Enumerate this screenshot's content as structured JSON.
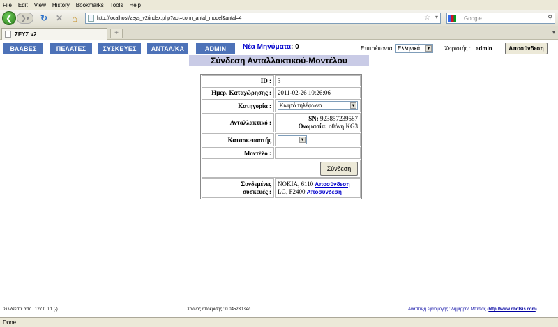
{
  "browser": {
    "menu": [
      "File",
      "Edit",
      "View",
      "History",
      "Bookmarks",
      "Tools",
      "Help"
    ],
    "url": "http://localhost/zeys_v2/index.php?act=conn_antal_model&antal=4",
    "search_placeholder": "Google",
    "tab_title": "ΖΕΥΣ v2",
    "status": "Done"
  },
  "nav": {
    "items": [
      "ΒΛΑΒΕΣ",
      "ΠΕΛΑΤΕΣ",
      "ΣΥΣΚΕΥΕΣ",
      "ΑΝΤΑΛ/ΚΑ",
      "ADMIN"
    ],
    "new_messages_label": "Νέα Μηνύματα",
    "new_messages_count": ": 0",
    "language_label": "Επιτρέπονται :",
    "language_value": "Ελληνικά",
    "user_label": "Χειριστής :",
    "user_name": "admin",
    "logout_label": "Αποσύνδεση"
  },
  "page": {
    "title": "Σύνδεση Ανταλλακτικού-Μοντέλου"
  },
  "form": {
    "id_label": "ID :",
    "id_value": "3",
    "date_label": "Ημερ. Καταχώρησης :",
    "date_value": "2011-02-26 10:26:06",
    "category_label": "Κατηγορία :",
    "category_value": "Κινητό τηλέφωνο",
    "part_label": "Ανταλλακτικό :",
    "part_sn_label": "SN:",
    "part_sn_value": "923857239587",
    "part_name_label": "Ονομασία:",
    "part_name_value": "οθόνη KG3",
    "manufacturer_label": "Κατασκευαστής",
    "manufacturer_value": "",
    "model_label": "Μοντέλο :",
    "connect_label": "Σύνδεση",
    "connected_label_line1": "Συνδεμένες",
    "connected_label_line2": "συσκευές :",
    "devices": [
      {
        "name": "NOKIA, 6110",
        "action": "Αποσύνδεση"
      },
      {
        "name": "LG, F2400",
        "action": "Αποσύνδεση"
      }
    ]
  },
  "footer": {
    "ip": "Συνδέεστε από : 127.0.0.1 (-)",
    "response_time": "Χρόνος απόκρισης : 0.045230 sec.",
    "credit_prefix": "Ανάπτυξη εφαρμογής : Δημήτρης Μπίσιας (",
    "credit_link": "http://www.dbotsis.com",
    "credit_suffix": ")"
  }
}
